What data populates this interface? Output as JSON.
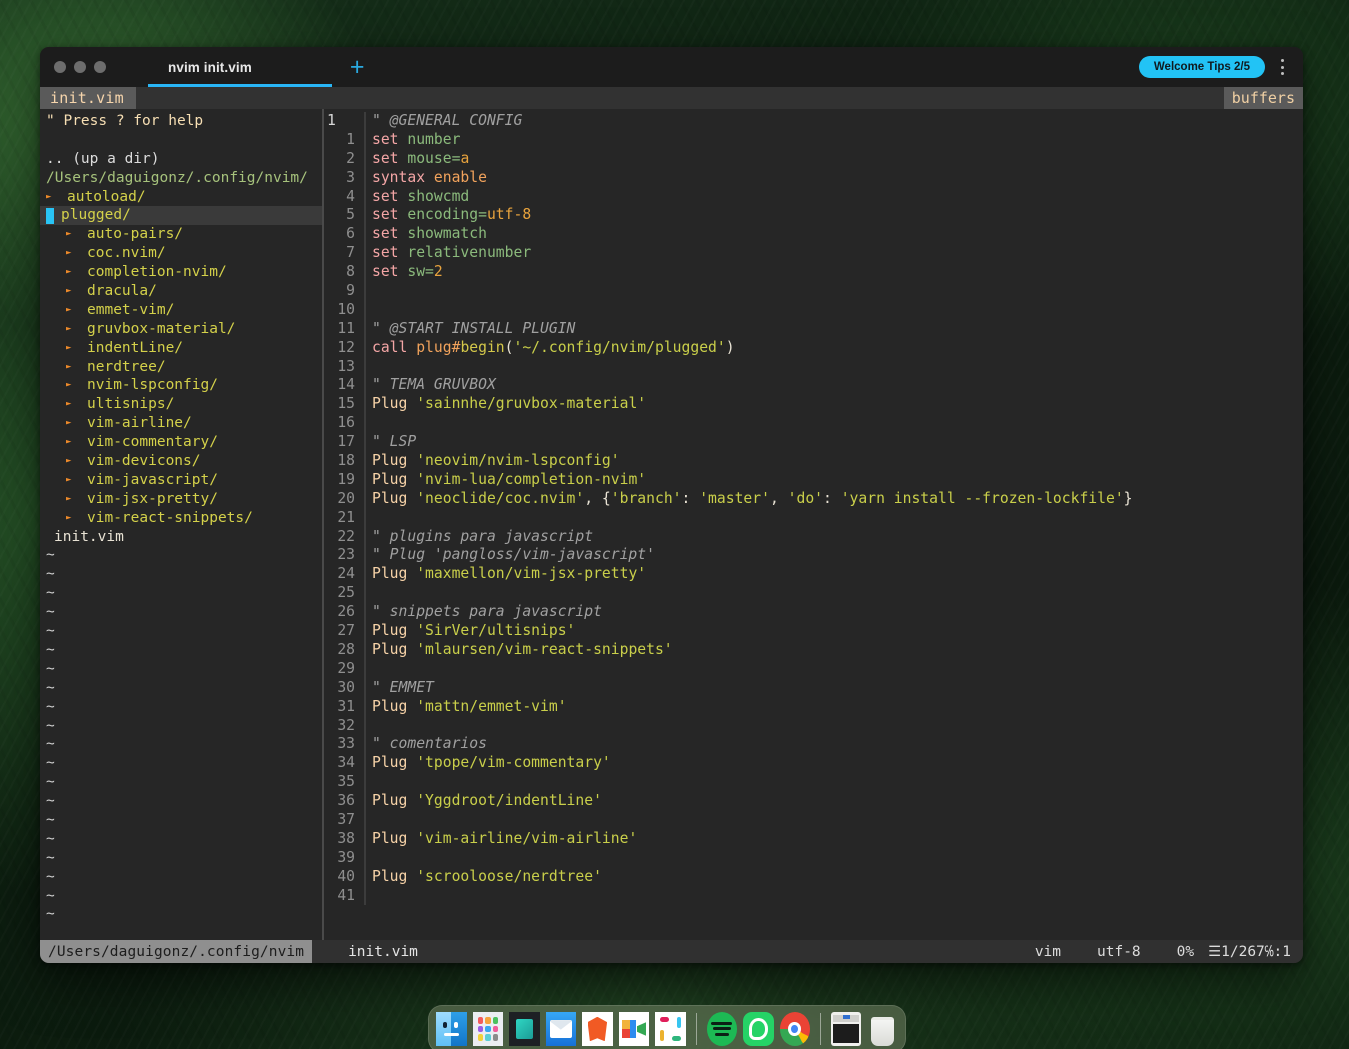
{
  "window": {
    "titlebar": {
      "tab_label": "nvim init.vim",
      "new_tab_label": "+",
      "welcome_tips": "Welcome Tips 2/5",
      "traffic_lights": [
        "close",
        "minimize",
        "zoom"
      ],
      "accent_color": "#29b6f6",
      "tips_color": "#22c3f5"
    },
    "bufferline": {
      "buffer_name": "init.vim",
      "right_label": "buffers"
    }
  },
  "nerdtree": {
    "help_hint": "\" Press ? for help",
    "up_dir": ".. (up a dir)",
    "root_path": "/Users/daguigonz/.config/nvim/",
    "entries": [
      {
        "label": "autoload/",
        "type": "dir",
        "indent": 1,
        "expanded": false,
        "selected": false
      },
      {
        "label": "plugged/",
        "type": "dir",
        "indent": 1,
        "expanded": true,
        "selected": true
      },
      {
        "label": "auto-pairs/",
        "type": "dir",
        "indent": 2,
        "expanded": false,
        "selected": false
      },
      {
        "label": "coc.nvim/",
        "type": "dir",
        "indent": 2,
        "expanded": false,
        "selected": false
      },
      {
        "label": "completion-nvim/",
        "type": "dir",
        "indent": 2,
        "expanded": false,
        "selected": false
      },
      {
        "label": "dracula/",
        "type": "dir",
        "indent": 2,
        "expanded": false,
        "selected": false
      },
      {
        "label": "emmet-vim/",
        "type": "dir",
        "indent": 2,
        "expanded": false,
        "selected": false
      },
      {
        "label": "gruvbox-material/",
        "type": "dir",
        "indent": 2,
        "expanded": false,
        "selected": false
      },
      {
        "label": "indentLine/",
        "type": "dir",
        "indent": 2,
        "expanded": false,
        "selected": false
      },
      {
        "label": "nerdtree/",
        "type": "dir",
        "indent": 2,
        "expanded": false,
        "selected": false
      },
      {
        "label": "nvim-lspconfig/",
        "type": "dir",
        "indent": 2,
        "expanded": false,
        "selected": false
      },
      {
        "label": "ultisnips/",
        "type": "dir",
        "indent": 2,
        "expanded": false,
        "selected": false
      },
      {
        "label": "vim-airline/",
        "type": "dir",
        "indent": 2,
        "expanded": false,
        "selected": false
      },
      {
        "label": "vim-commentary/",
        "type": "dir",
        "indent": 2,
        "expanded": false,
        "selected": false
      },
      {
        "label": "vim-devicons/",
        "type": "dir",
        "indent": 2,
        "expanded": false,
        "selected": false
      },
      {
        "label": "vim-javascript/",
        "type": "dir",
        "indent": 2,
        "expanded": false,
        "selected": false
      },
      {
        "label": "vim-jsx-pretty/",
        "type": "dir",
        "indent": 2,
        "expanded": false,
        "selected": false
      },
      {
        "label": "vim-react-snippets/",
        "type": "dir",
        "indent": 2,
        "expanded": false,
        "selected": false
      },
      {
        "label": "init.vim",
        "type": "file",
        "indent": 1,
        "expanded": false,
        "selected": false
      }
    ],
    "empty_marker": "~",
    "empty_marker_count": 20
  },
  "editor": {
    "filename": "init.vim",
    "cursor_line": 1,
    "lines": [
      {
        "num": "1",
        "cursor": true,
        "tokens": [
          {
            "t": "\" @GENERAL CONFIG",
            "c": "c-comment"
          }
        ]
      },
      {
        "num": "1",
        "cursor": false,
        "tokens": [
          {
            "t": "set",
            "c": "c-cmd"
          },
          {
            "t": " ",
            "c": "c-punct"
          },
          {
            "t": "number",
            "c": "c-opt"
          }
        ]
      },
      {
        "num": "2",
        "cursor": false,
        "tokens": [
          {
            "t": "set",
            "c": "c-cmd"
          },
          {
            "t": " ",
            "c": "c-punct"
          },
          {
            "t": "mouse=",
            "c": "c-opt"
          },
          {
            "t": "a",
            "c": "c-val"
          }
        ]
      },
      {
        "num": "3",
        "cursor": false,
        "tokens": [
          {
            "t": "syntax",
            "c": "c-cmd"
          },
          {
            "t": " ",
            "c": "c-punct"
          },
          {
            "t": "enable",
            "c": "c-kw"
          }
        ]
      },
      {
        "num": "4",
        "cursor": false,
        "tokens": [
          {
            "t": "set",
            "c": "c-cmd"
          },
          {
            "t": " ",
            "c": "c-punct"
          },
          {
            "t": "showcmd",
            "c": "c-opt"
          }
        ]
      },
      {
        "num": "5",
        "cursor": false,
        "tokens": [
          {
            "t": "set",
            "c": "c-cmd"
          },
          {
            "t": " ",
            "c": "c-punct"
          },
          {
            "t": "encoding=",
            "c": "c-opt"
          },
          {
            "t": "utf-8",
            "c": "c-val"
          }
        ]
      },
      {
        "num": "6",
        "cursor": false,
        "tokens": [
          {
            "t": "set",
            "c": "c-cmd"
          },
          {
            "t": " ",
            "c": "c-punct"
          },
          {
            "t": "showmatch",
            "c": "c-opt"
          }
        ]
      },
      {
        "num": "7",
        "cursor": false,
        "tokens": [
          {
            "t": "set",
            "c": "c-cmd"
          },
          {
            "t": " ",
            "c": "c-punct"
          },
          {
            "t": "relativenumber",
            "c": "c-opt"
          }
        ]
      },
      {
        "num": "8",
        "cursor": false,
        "tokens": [
          {
            "t": "set",
            "c": "c-cmd"
          },
          {
            "t": " ",
            "c": "c-punct"
          },
          {
            "t": "sw=",
            "c": "c-opt"
          },
          {
            "t": "2",
            "c": "c-val"
          }
        ]
      },
      {
        "num": "9",
        "cursor": false,
        "tokens": []
      },
      {
        "num": "10",
        "cursor": false,
        "tokens": []
      },
      {
        "num": "11",
        "cursor": false,
        "tokens": [
          {
            "t": "\" @START INSTALL PLUGIN",
            "c": "c-comment"
          }
        ]
      },
      {
        "num": "12",
        "cursor": false,
        "tokens": [
          {
            "t": "call",
            "c": "c-cmd"
          },
          {
            "t": " ",
            "c": "c-punct"
          },
          {
            "t": "plug#",
            "c": "c-kw"
          },
          {
            "t": "begin",
            "c": "c-func"
          },
          {
            "t": "(",
            "c": "c-punct"
          },
          {
            "t": "'~/.config/nvim/plugged'",
            "c": "c-str"
          },
          {
            "t": ")",
            "c": "c-punct"
          }
        ]
      },
      {
        "num": "13",
        "cursor": false,
        "tokens": []
      },
      {
        "num": "14",
        "cursor": false,
        "tokens": [
          {
            "t": "\" TEMA GRUVBOX",
            "c": "c-comment"
          }
        ]
      },
      {
        "num": "15",
        "cursor": false,
        "tokens": [
          {
            "t": "Plug",
            "c": "c-plug"
          },
          {
            "t": " ",
            "c": "c-punct"
          },
          {
            "t": "'sainnhe/gruvbox-material'",
            "c": "c-str"
          }
        ]
      },
      {
        "num": "16",
        "cursor": false,
        "tokens": []
      },
      {
        "num": "17",
        "cursor": false,
        "tokens": [
          {
            "t": "\" LSP",
            "c": "c-comment"
          }
        ]
      },
      {
        "num": "18",
        "cursor": false,
        "tokens": [
          {
            "t": "Plug",
            "c": "c-plug"
          },
          {
            "t": " ",
            "c": "c-punct"
          },
          {
            "t": "'neovim/nvim-lspconfig'",
            "c": "c-str"
          }
        ]
      },
      {
        "num": "19",
        "cursor": false,
        "tokens": [
          {
            "t": "Plug",
            "c": "c-plug"
          },
          {
            "t": " ",
            "c": "c-punct"
          },
          {
            "t": "'nvim-lua/completion-nvim'",
            "c": "c-str"
          }
        ]
      },
      {
        "num": "20",
        "cursor": false,
        "tokens": [
          {
            "t": "Plug",
            "c": "c-plug"
          },
          {
            "t": " ",
            "c": "c-punct"
          },
          {
            "t": "'neoclide/coc.nvim'",
            "c": "c-str"
          },
          {
            "t": ", {",
            "c": "c-punct"
          },
          {
            "t": "'branch'",
            "c": "c-str"
          },
          {
            "t": ": ",
            "c": "c-punct"
          },
          {
            "t": "'master'",
            "c": "c-str"
          },
          {
            "t": ", ",
            "c": "c-punct"
          },
          {
            "t": "'do'",
            "c": "c-str"
          },
          {
            "t": ": ",
            "c": "c-punct"
          },
          {
            "t": "'yarn install --frozen-lockfile'",
            "c": "c-str"
          },
          {
            "t": "}",
            "c": "c-punct"
          }
        ]
      },
      {
        "num": "21",
        "cursor": false,
        "tokens": []
      },
      {
        "num": "22",
        "cursor": false,
        "tokens": [
          {
            "t": "\" plugins para javascript",
            "c": "c-comment"
          }
        ]
      },
      {
        "num": "23",
        "cursor": false,
        "tokens": [
          {
            "t": "\" Plug 'pangloss/vim-javascript'",
            "c": "c-comment"
          }
        ]
      },
      {
        "num": "24",
        "cursor": false,
        "tokens": [
          {
            "t": "Plug",
            "c": "c-plug"
          },
          {
            "t": " ",
            "c": "c-punct"
          },
          {
            "t": "'maxmellon/vim-jsx-pretty'",
            "c": "c-str"
          }
        ]
      },
      {
        "num": "25",
        "cursor": false,
        "tokens": []
      },
      {
        "num": "26",
        "cursor": false,
        "tokens": [
          {
            "t": "\" snippets para javascript",
            "c": "c-comment"
          }
        ]
      },
      {
        "num": "27",
        "cursor": false,
        "tokens": [
          {
            "t": "Plug",
            "c": "c-plug"
          },
          {
            "t": " ",
            "c": "c-punct"
          },
          {
            "t": "'SirVer/ultisnips'",
            "c": "c-str"
          }
        ]
      },
      {
        "num": "28",
        "cursor": false,
        "tokens": [
          {
            "t": "Plug",
            "c": "c-plug"
          },
          {
            "t": " ",
            "c": "c-punct"
          },
          {
            "t": "'mlaursen/vim-react-snippets'",
            "c": "c-str"
          }
        ]
      },
      {
        "num": "29",
        "cursor": false,
        "tokens": []
      },
      {
        "num": "30",
        "cursor": false,
        "tokens": [
          {
            "t": "\" EMMET",
            "c": "c-comment"
          }
        ]
      },
      {
        "num": "31",
        "cursor": false,
        "tokens": [
          {
            "t": "Plug",
            "c": "c-plug"
          },
          {
            "t": " ",
            "c": "c-punct"
          },
          {
            "t": "'mattn/emmet-vim'",
            "c": "c-str"
          }
        ]
      },
      {
        "num": "32",
        "cursor": false,
        "tokens": []
      },
      {
        "num": "33",
        "cursor": false,
        "tokens": [
          {
            "t": "\" comentarios",
            "c": "c-comment"
          }
        ]
      },
      {
        "num": "34",
        "cursor": false,
        "tokens": [
          {
            "t": "Plug",
            "c": "c-plug"
          },
          {
            "t": " ",
            "c": "c-punct"
          },
          {
            "t": "'tpope/vim-commentary'",
            "c": "c-str"
          }
        ]
      },
      {
        "num": "35",
        "cursor": false,
        "tokens": []
      },
      {
        "num": "36",
        "cursor": false,
        "tokens": [
          {
            "t": "Plug",
            "c": "c-plug"
          },
          {
            "t": " ",
            "c": "c-punct"
          },
          {
            "t": "'Yggdroot/indentLine'",
            "c": "c-str"
          }
        ]
      },
      {
        "num": "37",
        "cursor": false,
        "tokens": []
      },
      {
        "num": "38",
        "cursor": false,
        "tokens": [
          {
            "t": "Plug",
            "c": "c-plug"
          },
          {
            "t": " ",
            "c": "c-punct"
          },
          {
            "t": "'vim-airline/vim-airline'",
            "c": "c-str"
          }
        ]
      },
      {
        "num": "39",
        "cursor": false,
        "tokens": []
      },
      {
        "num": "40",
        "cursor": false,
        "tokens": [
          {
            "t": "Plug",
            "c": "c-plug"
          },
          {
            "t": " ",
            "c": "c-punct"
          },
          {
            "t": "'scrooloose/nerdtree'",
            "c": "c-str"
          }
        ]
      },
      {
        "num": "41",
        "cursor": false,
        "tokens": []
      }
    ]
  },
  "statusline": {
    "path": "/Users/daguigonz/.config/nvim",
    "filename": "init.vim",
    "filetype": "vim",
    "encoding": "utf-8",
    "percent": "0%",
    "line_indicator": "☰",
    "position": "1/267",
    "col_icon": "℅",
    "column": ":1"
  },
  "dock": {
    "items": [
      {
        "name": "finder",
        "running": true
      },
      {
        "name": "launchpad",
        "running": false
      },
      {
        "name": "notes-app",
        "running": true
      },
      {
        "name": "mail",
        "running": true
      },
      {
        "name": "brave",
        "running": true
      },
      {
        "name": "google-meet",
        "running": false
      },
      {
        "name": "slack",
        "running": false
      },
      {
        "name": "separator",
        "running": false
      },
      {
        "name": "spotify",
        "running": true
      },
      {
        "name": "whatsapp",
        "running": false
      },
      {
        "name": "chrome",
        "running": false
      },
      {
        "name": "separator",
        "running": false
      },
      {
        "name": "terminal",
        "running": false
      },
      {
        "name": "trash",
        "running": false
      }
    ]
  }
}
